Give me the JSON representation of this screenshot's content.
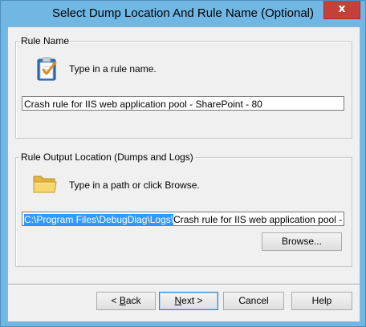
{
  "window": {
    "title": "Select Dump Location And Rule Name (Optional)",
    "close_glyph": "x"
  },
  "rule_name": {
    "legend": "Rule Name",
    "icon": "checklist-clipboard-icon",
    "hint": "Type in a rule name.",
    "value": "Crash rule for IIS web application pool - SharePoint - 80"
  },
  "output_location": {
    "legend": "Rule Output Location (Dumps and Logs)",
    "icon": "folder-icon",
    "hint": "Type in a path or click Browse.",
    "path_selected": "C:\\Program Files\\DebugDiag\\Logs\\",
    "path_rest": "Crash rule for IIS web application pool - Share",
    "browse_label": "Browse..."
  },
  "footer": {
    "back_prefix": "< ",
    "back_mnemonic": "B",
    "back_suffix": "ack",
    "next_mnemonic": "N",
    "next_suffix": "ext >",
    "cancel_label": "Cancel",
    "help_label": "Help"
  },
  "colors": {
    "title_bar": "#70b7e4",
    "close_button": "#c4413b",
    "selection": "#3399ff",
    "dialog_bg": "#f0f0f0"
  }
}
